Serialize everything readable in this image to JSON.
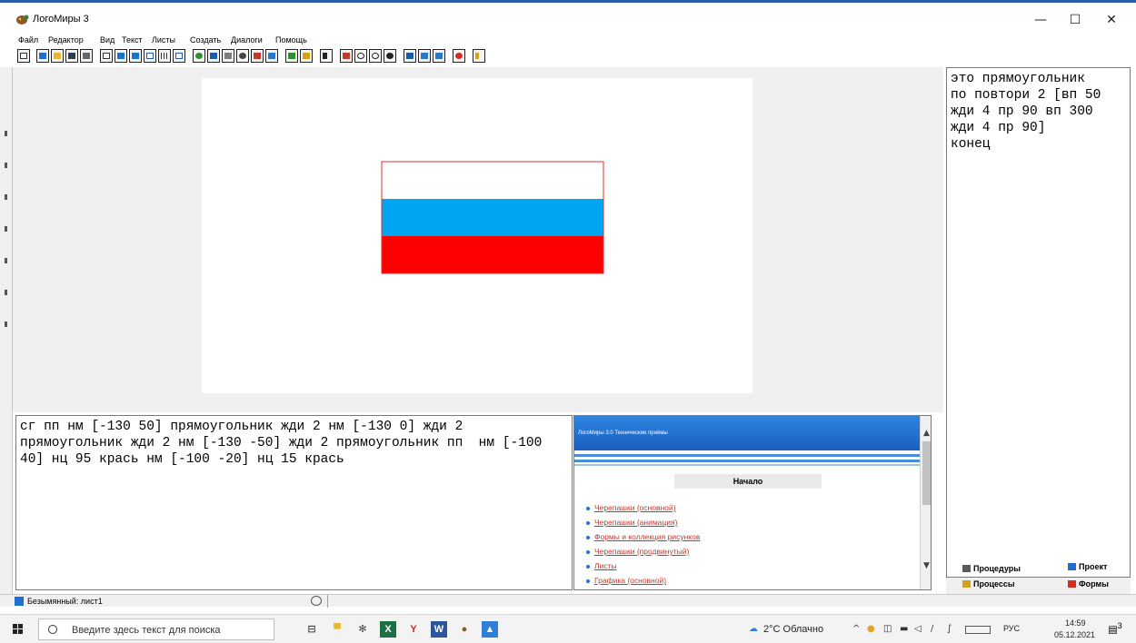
{
  "window": {
    "title": "ЛогоМиры 3",
    "minimize": "—",
    "maximize": "☐",
    "close": "✕"
  },
  "menu": [
    "Файл",
    "Редактор",
    "Вид",
    "Текст",
    "Листы",
    "Создать",
    "Диалоги",
    "Помощь"
  ],
  "command_text": "сг пп нм [-130 50] прямоугольник жди 2 нм [-130 0] жди 2 прямоугольник жди 2 нм [-130 -50] жди 2 прямоугольник пп  нм [-100 40] нц 95 крась нм [-100 -20] нц 15 крась",
  "procedures_text": "это прямоугольник\nпо повтори 2 [вп 50\nжди 4 пр 90 вп 300\nжди 4 пр 90]\nконец",
  "flag": {
    "stripes": [
      "#ffffff",
      "#00a5f2",
      "#ff0000"
    ],
    "outline": "#e03030"
  },
  "help": {
    "header": "ЛогоМиры 3.0 Технические приёмы",
    "start": "Начало",
    "links": [
      "Черепашки (основной)",
      "Черепашки (анимация)",
      "Формы и коллекция рисунков",
      "Черепашки (продвинутый)",
      "Листы",
      "Графика (основной)"
    ]
  },
  "tabs": {
    "procedures": "Процедуры",
    "project": "Проект",
    "processes": "Процессы",
    "forms": "Формы"
  },
  "status": {
    "sheet": "Безымянный: лист1"
  },
  "taskbar": {
    "search_placeholder": "Введите здесь текст для поиска",
    "weather": "2°C Облачно",
    "lang": "РУС",
    "time": "14:59",
    "date": "05.12.2021",
    "notifications": "3"
  }
}
